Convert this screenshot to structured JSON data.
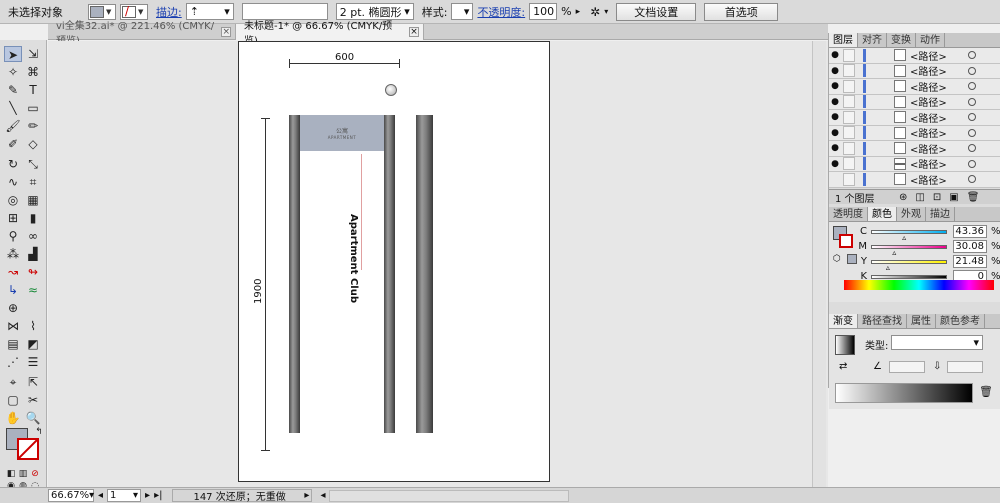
{
  "control_bar": {
    "selection_status": "未选择对象",
    "stroke_label": "描边:",
    "stroke_profile": "2 pt. 椭圆形",
    "style_label": "样式:",
    "opacity_label": "不透明度:",
    "opacity_value": "100",
    "opacity_unit": "%",
    "doc_settings_button": "文档设置",
    "preferences_button": "首选项"
  },
  "tabs": [
    {
      "label": "vi全集32.ai* @ 221.46% (CMYK/预览)",
      "close": "×"
    },
    {
      "label": "未标题-1* @ 66.67% (CMYK/预览)",
      "close": "×"
    }
  ],
  "artboard": {
    "dim_width": "600",
    "dim_height": "1900",
    "sign_top_text": "公寓",
    "sign_bottom_text": "APARTMENT",
    "vertical_text": "Apartment Club"
  },
  "layers_panel": {
    "tabs": [
      "图层",
      "对齐",
      "变换",
      "动作"
    ],
    "row_label": "<路径>",
    "rows": [
      "<路径>",
      "<路径>",
      "<路径>",
      "<路径>",
      "<路径>",
      "<路径>",
      "<路径>",
      "<路径>",
      "<路径>"
    ],
    "footer": "1 个图层"
  },
  "color_panel": {
    "tabs": [
      "透明度",
      "颜色",
      "外观",
      "描边"
    ],
    "channels": [
      {
        "label": "C",
        "value": "43.36",
        "level": 0.4336
      },
      {
        "label": "M",
        "value": "30.08",
        "level": 0.3008
      },
      {
        "label": "Y",
        "value": "21.48",
        "level": 0.2148
      },
      {
        "label": "K",
        "value": "0",
        "level": 0
      }
    ],
    "unit": "%"
  },
  "gradient_panel": {
    "tabs": [
      "渐变",
      "路径查找",
      "属性",
      "颜色参考"
    ],
    "type_label": "类型:"
  },
  "status_bar": {
    "zoom": "66.67%",
    "page": "1",
    "history": "147 次还原；无重做"
  },
  "colors": {
    "fill": "#aab1bf",
    "sign_panel": "#a9b1c0",
    "selection_blue": "#4a72d0"
  }
}
